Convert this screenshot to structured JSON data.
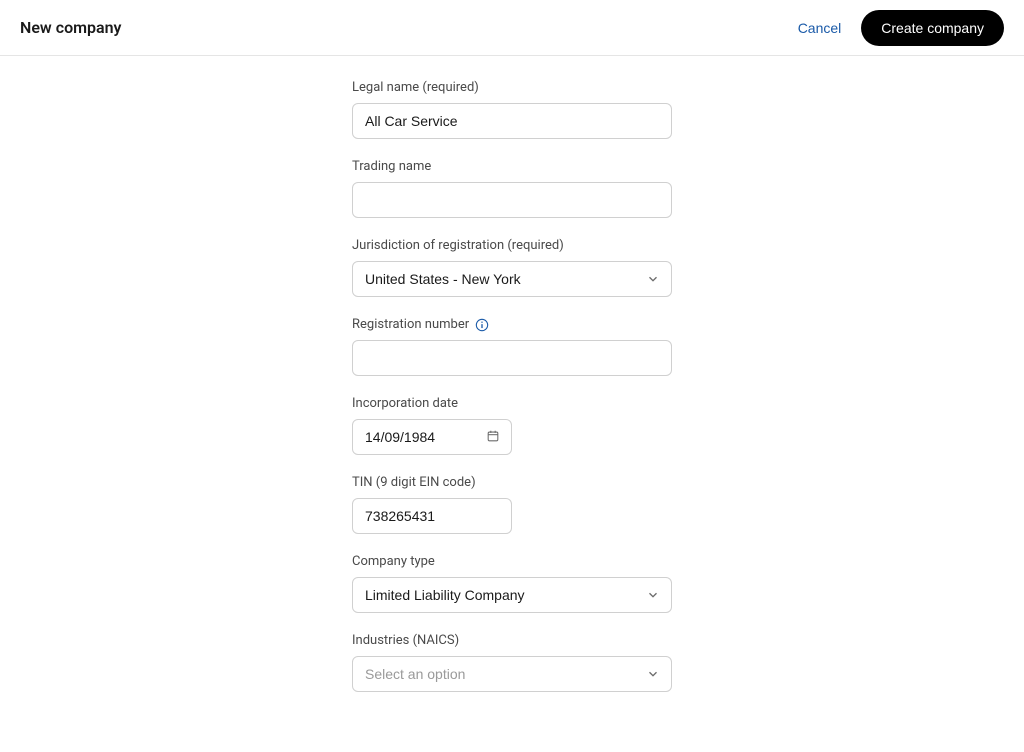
{
  "header": {
    "title": "New company",
    "cancel_label": "Cancel",
    "create_label": "Create company"
  },
  "form": {
    "legal_name": {
      "label": "Legal name (required)",
      "value": "All Car Service"
    },
    "trading_name": {
      "label": "Trading name",
      "value": ""
    },
    "jurisdiction": {
      "label": "Jurisdiction of registration (required)",
      "value": "United States - New York"
    },
    "registration_number": {
      "label": "Registration number",
      "value": ""
    },
    "incorporation_date": {
      "label": "Incorporation date",
      "value": "14/09/1984"
    },
    "tin": {
      "label": "TIN (9 digit EIN code)",
      "value": "738265431"
    },
    "company_type": {
      "label": "Company type",
      "value": "Limited Liability Company"
    },
    "industries": {
      "label": "Industries (NAICS)",
      "placeholder": "Select an option"
    }
  }
}
